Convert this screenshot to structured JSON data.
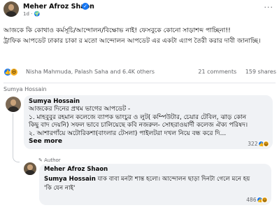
{
  "post": {
    "author": "Meher Afroz Shaon",
    "meta": "1d · 🌍",
    "more": "···",
    "lines": [
      "আজকে কি কোথাও কর্মসূচি/আন্দোলন/বিক্ষোভ নাই! ফেসবুকে কোনো সাড়াশব্দ পাচ্ছিনা!!",
      "ট্রাফিক আপডেট ঢাকার চাকা র মতো আন্দোলন আপডেট এর একটা এ্যাপ তৈরী করার দাবী জানাচ্ছি।"
    ]
  },
  "reactions": {
    "reactors": "Nisha Mahmuda, Palash Saha and 6.4K others",
    "comments": "21 comments",
    "shares": "159 shares",
    "icons": [
      "like-icon",
      "haha-icon"
    ]
  },
  "caption": "Sumya Hossain",
  "comment": {
    "author": "Sumya Hossain",
    "lines": [
      "আজকের দিনের প্রথম ভাগের আপডেট -",
      "১. মাহবুবুর রহমান কলেজে ব্যাপক ভাংচুর ও লুট( কম্পিউটার, চেয়ার টেবিল, ঝাড় কোন",
      "কিছু বাদ দেয়নি) সফল ভাবে চালিয়েছে কবি নজরুল- সোহরাওয়ার্দী কলেজ ঐক্য পরিষদ।",
      "২. আশারগাঁয়ে অটোরিকশা(বাংলার টেসলা) পাইলটরা দখল নিয়ে বন্ধ করে দি..."
    ],
    "see_more": "See more",
    "count": "322"
  },
  "reply": {
    "badge": "Author",
    "author": "Meher Afroz Shaon",
    "mention": "Sumya Hossain",
    "line1_rest": " যাক বাবা মনটা শান্ত হলো। আন্দোলন ছাড়া দিনটা গেলে মনে হয়",
    "line2": "'কি যেন নাই'",
    "count": "486"
  }
}
